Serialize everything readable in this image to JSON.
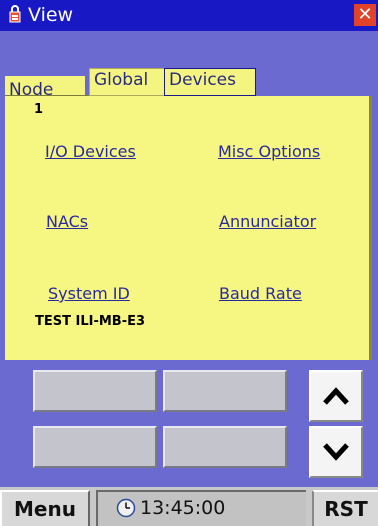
{
  "window": {
    "title": "View",
    "close_icon": "close-icon",
    "app_icon": "lock-icon"
  },
  "tabs": [
    {
      "label": "Node"
    },
    {
      "label": "Global"
    },
    {
      "label": "Devices"
    }
  ],
  "panel": {
    "number": "1",
    "links": {
      "io_devices": "I/O Devices",
      "misc_options": "Misc Options",
      "nacs": "NACs",
      "annunciator": "Annunciator",
      "system_id": "System ID",
      "baud_rate": "Baud Rate"
    },
    "system_id_value": "TEST ILI-MB-E3"
  },
  "scroll": {
    "up_icon": "chevron-up-icon",
    "down_icon": "chevron-down-icon"
  },
  "statusbar": {
    "menu_label": "Menu",
    "time": "13:45:00",
    "rst_label": "RST",
    "clock_icon": "clock-icon"
  },
  "colors": {
    "titlebar": "#1818c4",
    "background": "#6a6ad0",
    "panel": "#f6f683",
    "link": "#2a2aa0",
    "close": "#e0422a"
  }
}
